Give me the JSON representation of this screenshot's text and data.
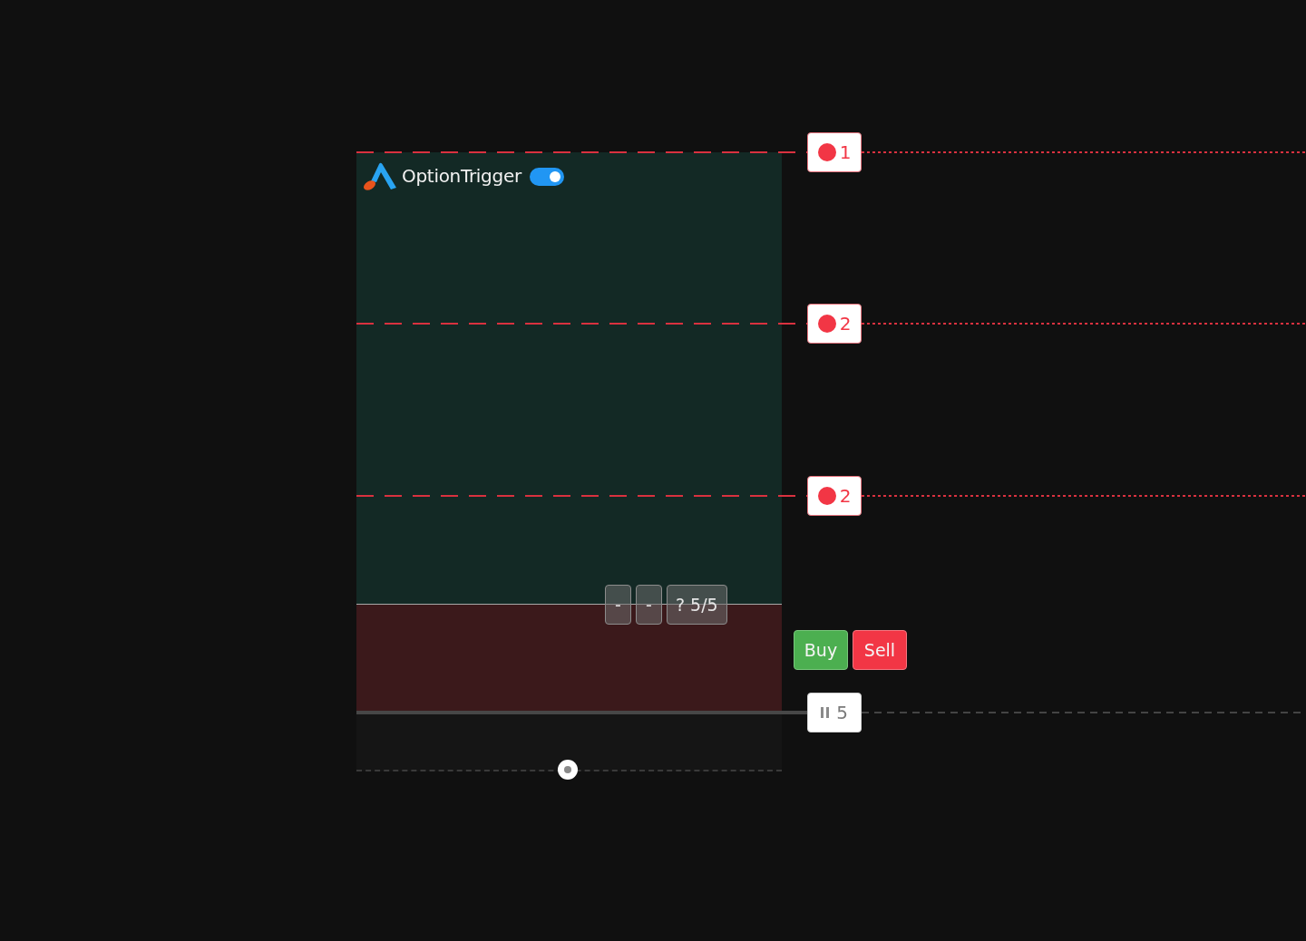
{
  "header": {
    "title": "OptionTrigger",
    "toggle": {
      "on": true
    }
  },
  "lines": [
    {
      "kind": "order",
      "label": "1"
    },
    {
      "kind": "order",
      "label": "2"
    },
    {
      "kind": "order",
      "label": "2"
    },
    {
      "kind": "position",
      "label": "5"
    }
  ],
  "toolbar": [
    {
      "label": "-"
    },
    {
      "label": "-"
    },
    {
      "label": "? 5/5"
    }
  ],
  "trade_buttons": [
    {
      "kind": "buy",
      "label": "Buy"
    },
    {
      "kind": "sell",
      "label": "Sell"
    }
  ]
}
